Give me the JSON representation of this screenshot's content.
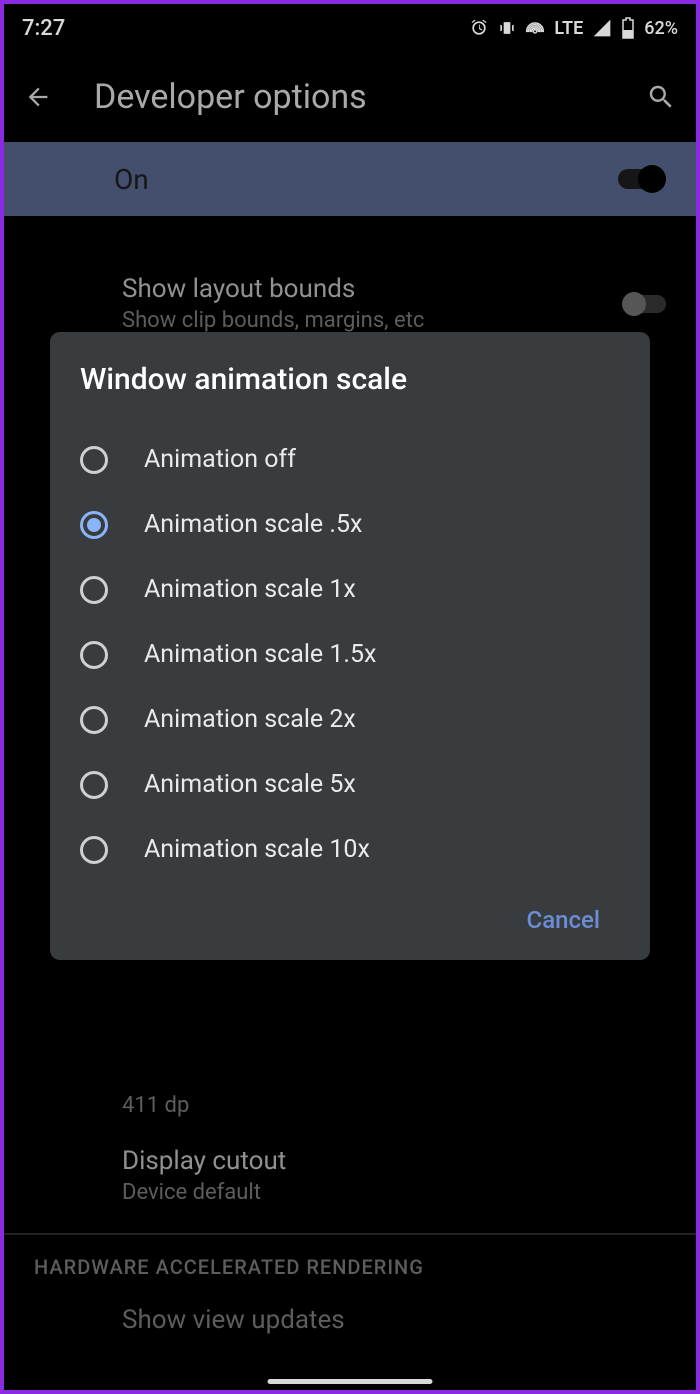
{
  "status": {
    "time": "7:27",
    "network": "LTE",
    "battery": "62%"
  },
  "header": {
    "title": "Developer options"
  },
  "mainToggle": {
    "label": "On"
  },
  "settings": {
    "layoutBounds": {
      "title": "Show layout bounds",
      "sub": "Show clip bounds, margins, etc"
    },
    "smallestWidth": {
      "sub": "411 dp"
    },
    "displayCutout": {
      "title": "Display cutout",
      "sub": "Device default"
    }
  },
  "sectionHeader": "HARDWARE ACCELERATED RENDERING",
  "viewUpdates": {
    "title": "Show view updates"
  },
  "dialog": {
    "title": "Window animation scale",
    "cancel": "Cancel",
    "options": [
      {
        "label": "Animation off",
        "selected": false
      },
      {
        "label": "Animation scale .5x",
        "selected": true
      },
      {
        "label": "Animation scale 1x",
        "selected": false
      },
      {
        "label": "Animation scale 1.5x",
        "selected": false
      },
      {
        "label": "Animation scale 2x",
        "selected": false
      },
      {
        "label": "Animation scale 5x",
        "selected": false
      },
      {
        "label": "Animation scale 10x",
        "selected": false
      }
    ]
  }
}
